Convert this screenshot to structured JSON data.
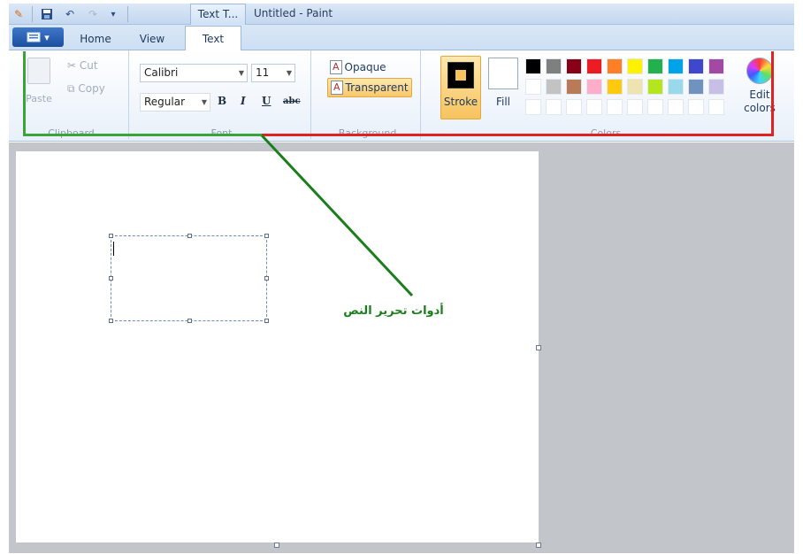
{
  "window": {
    "title": "Untitled - Paint",
    "context_tab_title": "Text T..."
  },
  "quick_access": {
    "app_icon": "paint-app-icon",
    "save_icon": "save-icon",
    "undo_icon": "undo-icon",
    "redo_icon": "redo-icon",
    "menu_icon": "customize-quick-access-icon"
  },
  "tabs": [
    {
      "label": "Home",
      "selected": false
    },
    {
      "label": "View",
      "selected": false
    },
    {
      "label": "Text",
      "selected": true
    }
  ],
  "ribbon": {
    "clipboard": {
      "label": "Clipboard",
      "paste": "Paste",
      "cut": "Cut",
      "copy": "Copy"
    },
    "font": {
      "label": "Font",
      "family": "Calibri",
      "size": "11",
      "style": "Regular",
      "bold": "B",
      "italic": "I",
      "underline": "U",
      "strikethrough": "abc"
    },
    "background": {
      "label": "Background",
      "opaque": "Opaque",
      "transparent": "Transparent",
      "selected": "Transparent"
    },
    "colors": {
      "label": "Colors",
      "stroke": "Stroke",
      "fill": "Fill",
      "edit_colors": "Edit colors",
      "palette_row1": [
        "#000000",
        "#7f7f7f",
        "#880015",
        "#ed1c24",
        "#ff7f27",
        "#fff200",
        "#22b14c",
        "#00a2e8",
        "#3f48cc",
        "#a349a4"
      ],
      "palette_row2": [
        "#ffffff",
        "#c3c3c3",
        "#b97a57",
        "#ffaec9",
        "#ffc90e",
        "#efe4b0",
        "#b5e61d",
        "#99d9ea",
        "#7092be",
        "#c8bfe7"
      ],
      "palette_row3": [
        "#ffffff",
        "#ffffff",
        "#ffffff",
        "#ffffff",
        "#ffffff",
        "#ffffff",
        "#ffffff",
        "#ffffff",
        "#ffffff",
        "#ffffff"
      ]
    }
  },
  "annotation": {
    "text": "أدوات تحرير النص",
    "line_color": "#1a7f1a",
    "left_bracket_color": "#3aa33a",
    "right_bracket_color": "#e02222"
  }
}
